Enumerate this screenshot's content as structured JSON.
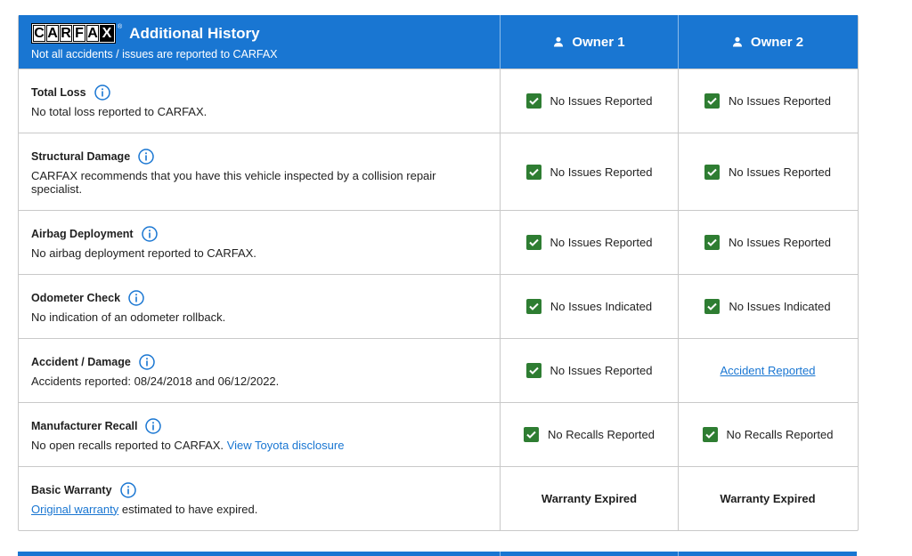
{
  "header": {
    "logo_letters": [
      "C",
      "A",
      "R",
      "F",
      "A",
      "X"
    ],
    "logo_tm": "®",
    "title": "Additional History",
    "subtitle": "Not all accidents / issues are reported to CARFAX",
    "owners": [
      "Owner 1",
      "Owner 2"
    ]
  },
  "rows": [
    {
      "title": "Total Loss",
      "desc": "No total loss reported to CARFAX.",
      "owner1": "No Issues Reported",
      "owner2": "No Issues Reported"
    },
    {
      "title": "Structural Damage",
      "desc": "CARFAX recommends that you have this vehicle inspected by a collision repair specialist.",
      "owner1": "No Issues Reported",
      "owner2": "No Issues Reported"
    },
    {
      "title": "Airbag Deployment",
      "desc": "No airbag deployment reported to CARFAX.",
      "owner1": "No Issues Reported",
      "owner2": "No Issues Reported"
    },
    {
      "title": "Odometer Check",
      "desc": "No indication of an odometer rollback.",
      "owner1": "No Issues Indicated",
      "owner2": "No Issues Indicated"
    },
    {
      "title": "Accident / Damage",
      "desc": "Accidents reported: 08/24/2018 and 06/12/2022.",
      "owner1": "No Issues Reported",
      "owner2_link": "Accident Reported"
    },
    {
      "title": "Manufacturer Recall",
      "desc": "No open recalls reported to CARFAX.",
      "desc_link": "View Toyota disclosure",
      "owner1": "No Recalls Reported",
      "owner2": "No Recalls Reported"
    },
    {
      "title": "Basic Warranty",
      "desc_link": "Original warranty",
      "desc_rest": "estimated to have expired.",
      "owner1": "Warranty Expired",
      "owner2": "Warranty Expired"
    }
  ],
  "colors": {
    "brand_blue": "#1976d2",
    "check_green": "#2e7d32",
    "border": "#c9c9c9"
  },
  "icons": {
    "owner": "person-icon",
    "info": "info-icon",
    "check": "checkbox-checked-icon"
  }
}
